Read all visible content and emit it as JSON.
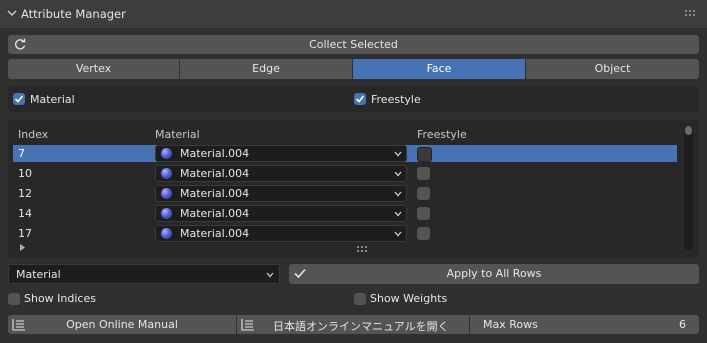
{
  "header": {
    "title": "Attribute Manager"
  },
  "collect_button": {
    "label": "Collect Selected"
  },
  "tabs": [
    {
      "label": "Vertex",
      "active": false
    },
    {
      "label": "Edge",
      "active": false
    },
    {
      "label": "Face",
      "active": true
    },
    {
      "label": "Object",
      "active": false
    }
  ],
  "filters": {
    "material": {
      "label": "Material",
      "checked": true
    },
    "freestyle": {
      "label": "Freestyle",
      "checked": true
    }
  },
  "table": {
    "headers": {
      "index": "Index",
      "material": "Material",
      "freestyle": "Freestyle"
    },
    "rows": [
      {
        "index": "7",
        "material": "Material.004",
        "freestyle": false,
        "selected": true
      },
      {
        "index": "10",
        "material": "Material.004",
        "freestyle": false,
        "selected": false
      },
      {
        "index": "12",
        "material": "Material.004",
        "freestyle": false,
        "selected": false
      },
      {
        "index": "14",
        "material": "Material.004",
        "freestyle": false,
        "selected": false
      },
      {
        "index": "17",
        "material": "Material.004",
        "freestyle": false,
        "selected": false
      }
    ]
  },
  "apply": {
    "dropdown_value": "Material",
    "button_label": "Apply to All Rows"
  },
  "options": {
    "show_indices": {
      "label": "Show Indices",
      "checked": false
    },
    "show_weights": {
      "label": "Show Weights",
      "checked": false
    }
  },
  "footer": {
    "manual_label": "Open Online Manual",
    "manual_jp_label": "日本語オンラインマニュアルを開く",
    "max_rows_label": "Max Rows",
    "max_rows_value": "6"
  },
  "colors": {
    "accent": "#4772b3",
    "panel": "#303030",
    "button": "#545454"
  }
}
